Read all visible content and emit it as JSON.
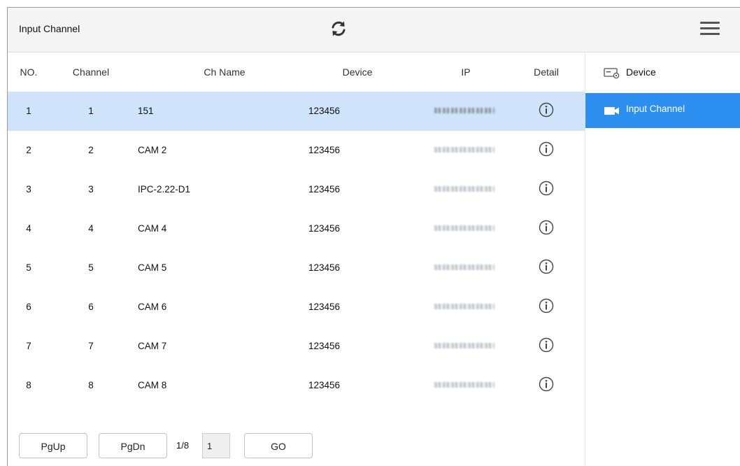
{
  "header": {
    "title": "Input Channel",
    "refresh_icon": "refresh-icon",
    "menu_icon": "hamburger-menu-icon"
  },
  "table": {
    "columns": [
      "NO.",
      "Channel",
      "Ch Name",
      "Device",
      "IP",
      "Detail"
    ],
    "rows": [
      {
        "no": "1",
        "channel": "1",
        "name": "151",
        "device": "123456",
        "ip": "",
        "selected": true
      },
      {
        "no": "2",
        "channel": "2",
        "name": "CAM 2",
        "device": "123456",
        "ip": ""
      },
      {
        "no": "3",
        "channel": "3",
        "name": "IPC-2.22-D1",
        "device": "123456",
        "ip": ""
      },
      {
        "no": "4",
        "channel": "4",
        "name": "CAM 4",
        "device": "123456",
        "ip": ""
      },
      {
        "no": "5",
        "channel": "5",
        "name": "CAM 5",
        "device": "123456",
        "ip": ""
      },
      {
        "no": "6",
        "channel": "6",
        "name": "CAM 6",
        "device": "123456",
        "ip": ""
      },
      {
        "no": "7",
        "channel": "7",
        "name": "CAM 7",
        "device": "123456",
        "ip": ""
      },
      {
        "no": "8",
        "channel": "8",
        "name": "CAM 8",
        "device": "123456",
        "ip": ""
      }
    ]
  },
  "pager": {
    "pgup_label": "PgUp",
    "pgdn_label": "PgDn",
    "page_info": "1/8",
    "page_input_value": "1",
    "go_label": "GO"
  },
  "sidebar": {
    "items": [
      {
        "label": "Device",
        "icon": "device-settings-icon",
        "active": false
      },
      {
        "label": "Input Channel",
        "icon": "camera-icon",
        "active": true
      }
    ]
  },
  "colors": {
    "accent": "#2d8ff0",
    "selected_row": "#cfe3fb",
    "header_bg": "#f4f4f4"
  }
}
